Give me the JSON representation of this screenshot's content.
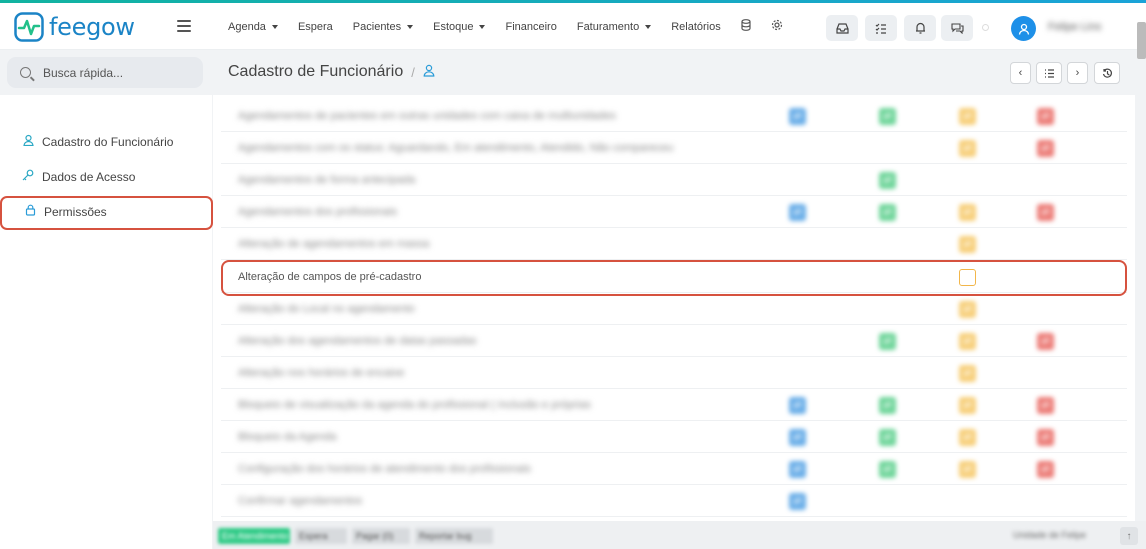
{
  "brand": {
    "name": "feegow",
    "color": "#1b84c6"
  },
  "nav": {
    "items": [
      {
        "label": "Agenda",
        "has_caret": true
      },
      {
        "label": "Espera",
        "has_caret": false
      },
      {
        "label": "Pacientes",
        "has_caret": true
      },
      {
        "label": "Estoque",
        "has_caret": true
      },
      {
        "label": "Financeiro",
        "has_caret": false
      },
      {
        "label": "Faturamento",
        "has_caret": true
      },
      {
        "label": "Relatórios",
        "has_caret": false
      }
    ],
    "extra_icons": [
      "database-icon",
      "settings-icon"
    ]
  },
  "toolbar": {
    "icons": [
      "inbox-icon",
      "tasks-icon",
      "bell-icon",
      "chat-icon"
    ]
  },
  "user": {
    "name": "Felipe Lins"
  },
  "search": {
    "placeholder": "Busca rápida..."
  },
  "sidebar": {
    "items": [
      {
        "label": "Cadastro do Funcionário",
        "icon": "user-icon"
      },
      {
        "label": "Dados de Acesso",
        "icon": "key-icon"
      },
      {
        "label": "Permissões",
        "icon": "lock-icon"
      }
    ]
  },
  "header": {
    "title": "Cadastro de Funcionário",
    "separator": "/"
  },
  "permissions": {
    "rows": [
      {
        "label": "Agendamentos de pacientes em outras unidades com caixa de multiunidades",
        "view": true,
        "add": true,
        "edit": true,
        "delete": true
      },
      {
        "label": "Agendamentos com os status: Aguardando, Em atendimento, Atendido, Não compareceu",
        "view": false,
        "add": false,
        "edit": true,
        "delete": true
      },
      {
        "label": "Agendamentos de forma antecipada",
        "view": false,
        "add": true,
        "edit": false,
        "delete": false
      },
      {
        "label": "Agendamentos dos profissionais",
        "view": true,
        "add": true,
        "edit": true,
        "delete": true
      },
      {
        "label": "Alteração de agendamentos em massa",
        "view": false,
        "add": false,
        "edit": true,
        "delete": false
      },
      {
        "label": "Alteração de campos de pré-cadastro",
        "view": false,
        "add": false,
        "edit": true,
        "delete": false,
        "focus": true
      },
      {
        "label": "Alteração do Local no agendamento",
        "view": false,
        "add": false,
        "edit": true,
        "delete": false
      },
      {
        "label": "Alteração dos agendamentos de datas passadas",
        "view": false,
        "add": true,
        "edit": true,
        "delete": true
      },
      {
        "label": "Alteração nos horários de encaixe",
        "view": false,
        "add": false,
        "edit": true,
        "delete": false
      },
      {
        "label": "Bloqueio de visualização da agenda do profissional ( Inclusão e próprias",
        "view": true,
        "add": true,
        "edit": true,
        "delete": true
      },
      {
        "label": "Bloqueio da Agenda",
        "view": true,
        "add": true,
        "edit": true,
        "delete": true
      },
      {
        "label": "Configuração dos horários de atendimento dos profissionais",
        "view": true,
        "add": true,
        "edit": true,
        "delete": true
      },
      {
        "label": "Confirmar agendamentos",
        "view": true,
        "add": false,
        "edit": false,
        "delete": false
      }
    ]
  },
  "footer": {
    "buttons": [
      "Em Atendimento",
      "Espera",
      "Pagar (0)",
      "Reportar bug"
    ],
    "right_text": "Unidade de Felipe"
  },
  "colors": {
    "view": "#6aaee8",
    "add": "#6fd59a",
    "edit": "#f7cf7a",
    "delete": "#ec7d78",
    "highlight": "#d6523f"
  }
}
